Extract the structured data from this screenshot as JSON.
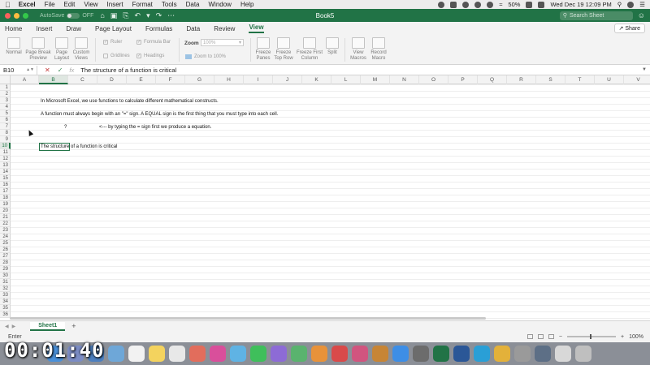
{
  "menubar": {
    "app": "Excel",
    "items": [
      "File",
      "Edit",
      "View",
      "Insert",
      "Format",
      "Tools",
      "Data",
      "Window",
      "Help"
    ],
    "battery": "50%",
    "clock": "Wed Dec 19  12:09 PM"
  },
  "titlebar": {
    "autosave_label": "AutoSave",
    "autosave_state": "OFF",
    "doc_title": "Book5",
    "search_placeholder": "Search Sheet"
  },
  "ribbon_tabs": [
    "Home",
    "Insert",
    "Draw",
    "Page Layout",
    "Formulas",
    "Data",
    "Review",
    "View"
  ],
  "active_tab": "View",
  "share_label": "Share",
  "ribbon": {
    "normal": "Normal",
    "page_break_1": "Page Break",
    "page_break_2": "Preview",
    "page_layout_1": "Page",
    "page_layout_2": "Layout",
    "custom_views_1": "Custom",
    "custom_views_2": "Views",
    "ruler": "Ruler",
    "formula_bar": "Formula Bar",
    "gridlines": "Gridlines",
    "headings": "Headings",
    "zoom_label": "Zoom",
    "zoom_value": "100%",
    "zoom_100": "Zoom to 100%",
    "freeze_panes_1": "Freeze",
    "freeze_panes_2": "Panes",
    "freeze_top_1": "Freeze",
    "freeze_top_2": "Top Row",
    "freeze_first_1": "Freeze First",
    "freeze_first_2": "Column",
    "split": "Split",
    "view_macros_1": "View",
    "view_macros_2": "Macros",
    "record_macro_1": "Record",
    "record_macro_2": "Macro"
  },
  "formula_bar": {
    "name_box": "B10",
    "fx": "fx",
    "content": "The structure of a function is critical"
  },
  "columns": [
    "A",
    "B",
    "C",
    "D",
    "E",
    "F",
    "G",
    "H",
    "I",
    "J",
    "K",
    "L",
    "M",
    "N",
    "O",
    "P",
    "Q",
    "R",
    "S",
    "T",
    "U",
    "V"
  ],
  "rows": [
    "1",
    "2",
    "3",
    "4",
    "5",
    "6",
    "7",
    "8",
    "9",
    "10",
    "11",
    "12",
    "13",
    "14",
    "15",
    "16",
    "17",
    "18",
    "19",
    "20",
    "21",
    "22",
    "23",
    "24",
    "25",
    "26",
    "27",
    "28",
    "29",
    "30",
    "31",
    "32",
    "33",
    "34",
    "35",
    "36"
  ],
  "cells": {
    "b3": "In Microsoft Excel, we use functions to calculate different mathematical constructs.",
    "b5": "A function must always begin with an \"=\" sign. A EQUAL sign is the first thing that you must type into each cell.",
    "b7": "?",
    "d7": "<--- by typing the = sign first we produce a equation.",
    "b10": "The structure of a function is critical"
  },
  "sheet_tab": "Sheet1",
  "status": {
    "mode": "Enter",
    "zoom": "100%"
  },
  "timer": "00:01:40"
}
